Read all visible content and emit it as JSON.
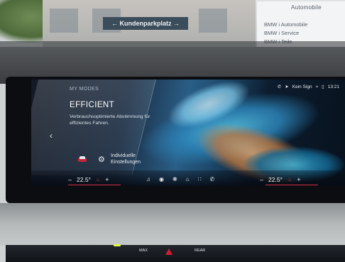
{
  "scene": {
    "street_sign": "← Kundenparkplatz →",
    "dealer_sign": {
      "brand_line": "Automobile",
      "rows": [
        "BMW  i Automobile",
        "BMW  i Service",
        "BMW  i Teile"
      ]
    }
  },
  "status_bar": {
    "icons": [
      "phone-icon",
      "navigation-arrow-icon",
      "wifi-off-icon",
      "battery-icon"
    ],
    "signal_text": "Kein Sign",
    "time": "13:21"
  },
  "modes": {
    "header": "MY MODES",
    "title": "EFFICIENT",
    "description": "Verbrauchsoptimierte Abstimmung für effizientes Fahren.",
    "individual_settings": "Individuelle Einstellungen"
  },
  "climate": {
    "left": {
      "temp": "22.5°",
      "minus": "–",
      "plus": "+"
    },
    "right": {
      "temp": "22.5°",
      "minus": "–",
      "plus": "+"
    }
  },
  "dock": {
    "icons": [
      "music-icon",
      "media-icon",
      "fan-icon",
      "home-icon",
      "apps-icon",
      "phone-icon"
    ]
  },
  "console": {
    "buttons": [
      {
        "label": "MAX"
      },
      {
        "label": "REAR"
      }
    ]
  },
  "colors": {
    "accent_red": "#d92f45",
    "screen_bg": "#0d1c2e",
    "text_primary": "#ffffff"
  }
}
